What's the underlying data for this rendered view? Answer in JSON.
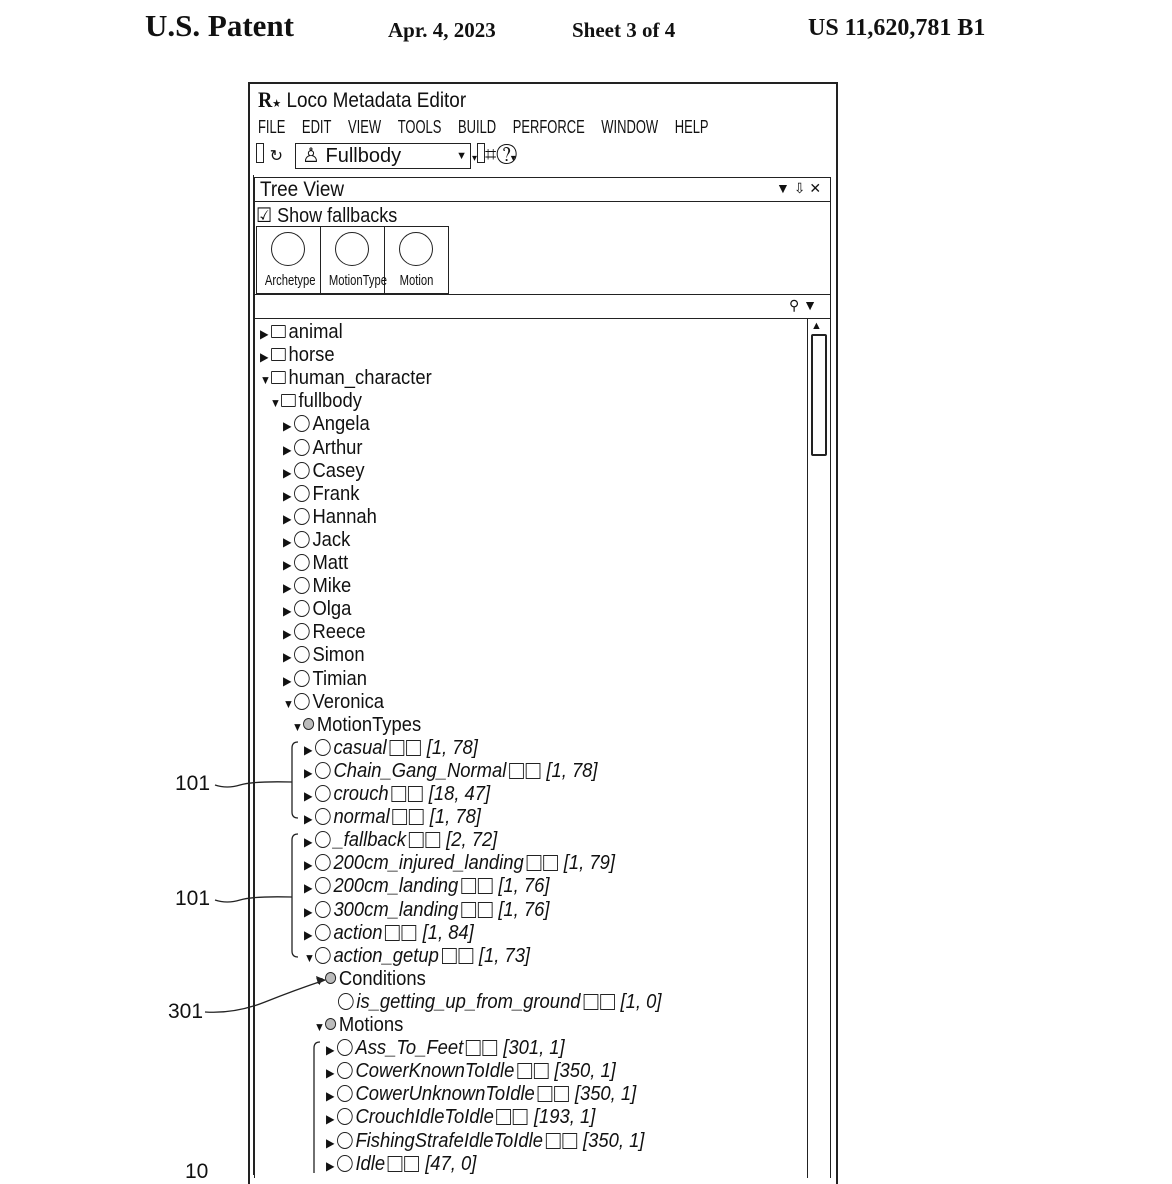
{
  "patent_header": {
    "left": "U.S. Patent",
    "date": "Apr. 4, 2023",
    "sheet": "Sheet 3 of 4",
    "number": "US 11,620,781 B1"
  },
  "window": {
    "logo": "R",
    "title": "Loco Metadata Editor",
    "menu": [
      "FILE",
      "EDIT",
      "VIEW",
      "TOOLS",
      "BUILD",
      "PERFORCE",
      "WINDOW",
      "HELP"
    ],
    "toolbar": {
      "combo_value": "Fullbody",
      "icons": [
        "refresh-icon",
        "person-icon",
        "dropdown-arrow-icon",
        "hash-icon",
        "help-icon"
      ]
    }
  },
  "tree_view": {
    "title": "Tree View",
    "panel_controls": "▼ ⇩ ✕",
    "show_fallbacks_label": "Show fallbacks",
    "show_fallbacks_checked": true,
    "filter_tabs": [
      "Archetype",
      "MotionType",
      "Motion"
    ],
    "items": [
      {
        "level": 0,
        "arrow": "▶",
        "icon": "folder",
        "label": "animal"
      },
      {
        "level": 0,
        "arrow": "▶",
        "icon": "folder",
        "label": "horse"
      },
      {
        "level": 0,
        "arrow": "▼",
        "icon": "folder",
        "label": "human_character"
      },
      {
        "level": 1,
        "arrow": "▼",
        "icon": "folder",
        "label": "fullbody"
      },
      {
        "level": 2,
        "arrow": "▶",
        "icon": "circle",
        "label": "Angela"
      },
      {
        "level": 2,
        "arrow": "▶",
        "icon": "circle",
        "label": "Arthur"
      },
      {
        "level": 2,
        "arrow": "▶",
        "icon": "circle",
        "label": "Casey"
      },
      {
        "level": 2,
        "arrow": "▶",
        "icon": "circle",
        "label": "Frank"
      },
      {
        "level": 2,
        "arrow": "▶",
        "icon": "circle",
        "label": "Hannah"
      },
      {
        "level": 2,
        "arrow": "▶",
        "icon": "circle",
        "label": "Jack"
      },
      {
        "level": 2,
        "arrow": "▶",
        "icon": "circle",
        "label": "Matt"
      },
      {
        "level": 2,
        "arrow": "▶",
        "icon": "circle",
        "label": "Mike"
      },
      {
        "level": 2,
        "arrow": "▶",
        "icon": "circle",
        "label": "Olga"
      },
      {
        "level": 2,
        "arrow": "▶",
        "icon": "circle",
        "label": "Reece"
      },
      {
        "level": 2,
        "arrow": "▶",
        "icon": "circle",
        "label": "Simon"
      },
      {
        "level": 2,
        "arrow": "▶",
        "icon": "circle",
        "label": "Timian"
      },
      {
        "level": 2,
        "arrow": "▼",
        "icon": "circle",
        "label": "Veronica"
      },
      {
        "level": 3,
        "arrow": "▼",
        "icon": "link",
        "label": "MotionTypes"
      },
      {
        "level": 4,
        "arrow": "▶",
        "icon": "circle",
        "label": "casual",
        "range": "[1, 78]",
        "italic": true
      },
      {
        "level": 4,
        "arrow": "▶",
        "icon": "circle",
        "label": "Chain_Gang_Normal",
        "range": "[1, 78]",
        "italic": true
      },
      {
        "level": 4,
        "arrow": "▶",
        "icon": "circle",
        "label": "crouch",
        "range": "[18, 47]",
        "italic": true
      },
      {
        "level": 4,
        "arrow": "▶",
        "icon": "circle",
        "label": "normal",
        "range": "[1, 78]",
        "italic": true
      },
      {
        "level": 4,
        "arrow": "▶",
        "icon": "circle",
        "label": "_fallback",
        "range": "[2, 72]",
        "italic": true
      },
      {
        "level": 4,
        "arrow": "▶",
        "icon": "circle",
        "label": "200cm_injured_landing",
        "range": "[1, 79]",
        "italic": true
      },
      {
        "level": 4,
        "arrow": "▶",
        "icon": "circle",
        "label": "200cm_landing",
        "range": "[1, 76]",
        "italic": true
      },
      {
        "level": 4,
        "arrow": "▶",
        "icon": "circle",
        "label": "300cm_landing",
        "range": "[1, 76]",
        "italic": true
      },
      {
        "level": 4,
        "arrow": "▶",
        "icon": "circle",
        "label": "action",
        "range": "[1, 84]",
        "italic": true
      },
      {
        "level": 4,
        "arrow": "▼",
        "icon": "circle",
        "label": "action_getup",
        "range": "[1, 73]",
        "italic": true
      },
      {
        "level": 5,
        "arrow": "▼",
        "icon": "link",
        "label": "Conditions"
      },
      {
        "level": 6,
        "arrow": "",
        "icon": "circle",
        "label": "is_getting_up_from_ground",
        "range": "[1, 0]",
        "italic": true
      },
      {
        "level": 5,
        "arrow": "▼",
        "icon": "link",
        "label": "Motions"
      },
      {
        "level": 7,
        "arrow": "▶",
        "icon": "circle",
        "label": "Ass_To_Feet",
        "range": "[301, 1]",
        "italic": true
      },
      {
        "level": 7,
        "arrow": "▶",
        "icon": "circle",
        "label": "CowerKnownToIdle",
        "range": "[350, 1]",
        "italic": true
      },
      {
        "level": 7,
        "arrow": "▶",
        "icon": "circle",
        "label": "CowerUnknownToIdle",
        "range": "[350, 1]",
        "italic": true
      },
      {
        "level": 7,
        "arrow": "▶",
        "icon": "circle",
        "label": "CrouchIdleToIdle",
        "range": "[193, 1]",
        "italic": true
      },
      {
        "level": 7,
        "arrow": "▶",
        "icon": "circle",
        "label": "FishingStrafeIdleToIdle",
        "range": "[350, 1]",
        "italic": true
      },
      {
        "level": 7,
        "arrow": "▶",
        "icon": "circle",
        "label": "Idle",
        "range": "[47, 0]",
        "italic": true
      }
    ]
  },
  "reference_numerals": [
    "101",
    "101",
    "301",
    "10"
  ]
}
